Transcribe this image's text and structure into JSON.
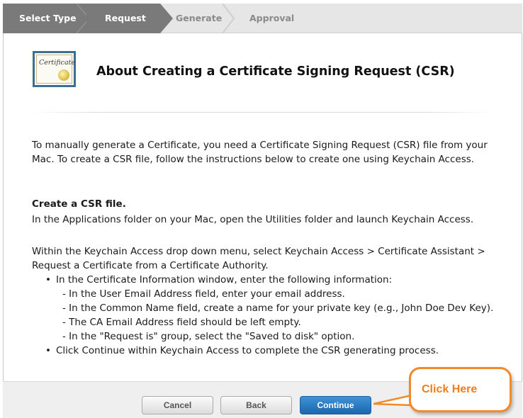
{
  "steps": [
    {
      "label": "Select Type",
      "state": "done"
    },
    {
      "label": "Request",
      "state": "current"
    },
    {
      "label": "Generate",
      "state": "upcoming"
    },
    {
      "label": "Approval",
      "state": "upcoming"
    }
  ],
  "header": {
    "icon_text": "Certificate",
    "title": "About Creating a Certificate Signing Request (CSR)"
  },
  "intro": {
    "line1": "To manually generate a Certificate, you need a Certificate Signing Request (CSR) file from your",
    "line2": "Mac. To create a CSR file, follow the instructions below to create one using Keychain Access."
  },
  "section": {
    "heading": "Create a CSR file.",
    "line": "In the Applications folder on your Mac, open the Utilities folder and launch Keychain Access."
  },
  "instructions": {
    "line1": "Within the Keychain Access drop down menu, select Keychain Access > Certificate Assistant >",
    "line2": "Request a Certificate from a Certificate Authority.",
    "bullet1": "In the Certificate Information window, enter the following information:",
    "sub1": "- In the User Email Address field, enter your email address.",
    "sub2": "- In the Common Name field, create a name for your private key (e.g., John Doe Dev Key).",
    "sub3": "- The CA Email Address field should be left empty.",
    "sub4": "- In the \"Request is\" group, select the \"Saved to disk\" option.",
    "bullet2": "Click Continue within Keychain Access to complete the CSR generating process.",
    "bullet_glyph": "•"
  },
  "footer": {
    "cancel_label": "Cancel",
    "back_label": "Back",
    "continue_label": "Continue"
  },
  "callout": {
    "text": "Click Here"
  },
  "colors": {
    "accent": "#2a7bc4",
    "callout": "#f08a2b",
    "step_done": "#7a7a7a",
    "cert_border": "#3b6f96"
  }
}
